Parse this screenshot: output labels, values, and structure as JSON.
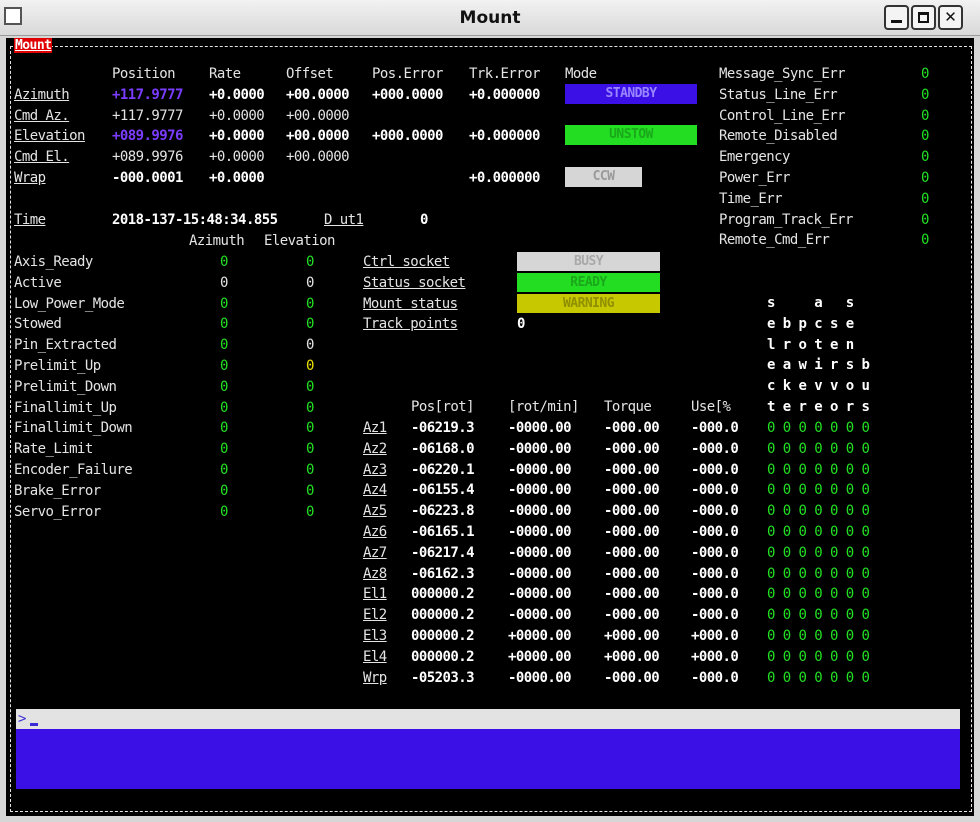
{
  "window": {
    "title": "Mount"
  },
  "frame_title": "Mount",
  "headers": {
    "position": "Position",
    "rate": "Rate",
    "offset": "Offset",
    "pos_error": "Pos.Error",
    "trk_error": "Trk.Error",
    "mode": "Mode"
  },
  "rows": {
    "azimuth": {
      "label": "Azimuth",
      "position": "+117.9777",
      "rate": "+0.0000",
      "offset": "+00.0000",
      "pos_error": "+000.0000",
      "trk_error": "+0.000000",
      "mode": "STANDBY"
    },
    "cmd_az": {
      "label": "Cmd Az.",
      "position": "+117.9777",
      "rate": "+0.0000",
      "offset": "+00.0000"
    },
    "elevation": {
      "label": "Elevation",
      "position": "+089.9976",
      "rate": "+0.0000",
      "offset": "+00.0000",
      "pos_error": "+000.0000",
      "trk_error": "+0.000000",
      "mode": "UNSTOW"
    },
    "cmd_el": {
      "label": "Cmd El.",
      "position": "+089.9976",
      "rate": "+0.0000",
      "offset": "+00.0000"
    },
    "wrap": {
      "label": "Wrap",
      "position": "-000.0001",
      "rate": "+0.0000",
      "trk_error": "+0.000000",
      "mode": "CCW"
    }
  },
  "time": {
    "label": "Time",
    "value": "2018-137-15:48:34.855",
    "dut1_label": "D ut1",
    "dut1_value": "0"
  },
  "axis_headers": {
    "azimuth": "Azimuth",
    "elevation": "Elevation"
  },
  "axis_status": [
    {
      "label": "Axis_Ready",
      "az": "0",
      "el": "0",
      "az_color": "g",
      "el_color": "g"
    },
    {
      "label": "Active",
      "az": "0",
      "el": "0",
      "az_color": "w",
      "el_color": "w"
    },
    {
      "label": "Low_Power_Mode",
      "az": "0",
      "el": "0",
      "az_color": "g",
      "el_color": "g"
    },
    {
      "label": "Stowed",
      "az": "0",
      "el": "0",
      "az_color": "g",
      "el_color": "g"
    },
    {
      "label": "Pin_Extracted",
      "az": "0",
      "el": "0",
      "az_color": "g",
      "el_color": "w"
    },
    {
      "label": "Prelimit_Up",
      "az": "0",
      "el": "0",
      "az_color": "g",
      "el_color": "y"
    },
    {
      "label": "Prelimit_Down",
      "az": "0",
      "el": "0",
      "az_color": "g",
      "el_color": "g"
    },
    {
      "label": "Finallimit_Up",
      "az": "0",
      "el": "0",
      "az_color": "g",
      "el_color": "g"
    },
    {
      "label": "Finallimit_Down",
      "az": "0",
      "el": "0",
      "az_color": "g",
      "el_color": "g"
    },
    {
      "label": "Rate_Limit",
      "az": "0",
      "el": "0",
      "az_color": "g",
      "el_color": "g"
    },
    {
      "label": "Encoder_Failure",
      "az": "0",
      "el": "0",
      "az_color": "g",
      "el_color": "g"
    },
    {
      "label": "Brake_Error",
      "az": "0",
      "el": "0",
      "az_color": "g",
      "el_color": "g"
    },
    {
      "label": "Servo_Error",
      "az": "0",
      "el": "0",
      "az_color": "g",
      "el_color": "g"
    }
  ],
  "status_links": [
    {
      "label": "Ctrl socket",
      "badge": "BUSY",
      "bg": "#d6d6d6",
      "fg": "#a8a8a8"
    },
    {
      "label": "Status socket",
      "badge": "READY",
      "bg": "#22dd22",
      "fg": "#1aa81a"
    },
    {
      "label": "Mount status",
      "badge": "WARNING",
      "bg": "#c8c800",
      "fg": "#8f8f00"
    },
    {
      "label": "Track points",
      "value": "0"
    }
  ],
  "errors": [
    {
      "label": "Message_Sync_Err",
      "value": "0"
    },
    {
      "label": "Status_Line_Err",
      "value": "0"
    },
    {
      "label": "Control_Line_Err",
      "value": "0"
    },
    {
      "label": "Remote_Disabled",
      "value": "0"
    },
    {
      "label": "Emergency",
      "value": "0"
    },
    {
      "label": "Power_Err",
      "value": "0"
    },
    {
      "label": "Time_Err",
      "value": "0"
    },
    {
      "label": "Program_Track_Err",
      "value": "0"
    },
    {
      "label": "Remote_Cmd_Err",
      "value": "0"
    }
  ],
  "motor_headers": {
    "pos": "Pos[rot]",
    "rpm": "[rot/min]",
    "torque": "Torque",
    "use": "Use[%"
  },
  "flag_header_rows": [
    "s     a   s  ",
    "e b p c s e  ",
    "l r o t e n  ",
    "e a w i r s b",
    "c k e v v o u",
    "t e r e o r s"
  ],
  "motors": [
    {
      "label": "Az1",
      "pos": "-06219.3",
      "rpm": "-0000.00",
      "torque": "-000.00",
      "use": "-000.0",
      "flags": "0 0 0 0 0 0 0"
    },
    {
      "label": "Az2",
      "pos": "-06168.0",
      "rpm": "-0000.00",
      "torque": "-000.00",
      "use": "-000.0",
      "flags": "0 0 0 0 0 0 0"
    },
    {
      "label": "Az3",
      "pos": "-06220.1",
      "rpm": "-0000.00",
      "torque": "-000.00",
      "use": "-000.0",
      "flags": "0 0 0 0 0 0 0"
    },
    {
      "label": "Az4",
      "pos": "-06155.4",
      "rpm": "-0000.00",
      "torque": "-000.00",
      "use": "-000.0",
      "flags": "0 0 0 0 0 0 0"
    },
    {
      "label": "Az5",
      "pos": "-06223.8",
      "rpm": "-0000.00",
      "torque": "-000.00",
      "use": "-000.0",
      "flags": "0 0 0 0 0 0 0"
    },
    {
      "label": "Az6",
      "pos": "-06165.1",
      "rpm": "-0000.00",
      "torque": "-000.00",
      "use": "-000.0",
      "flags": "0 0 0 0 0 0 0"
    },
    {
      "label": "Az7",
      "pos": "-06217.4",
      "rpm": "-0000.00",
      "torque": "-000.00",
      "use": "-000.0",
      "flags": "0 0 0 0 0 0 0"
    },
    {
      "label": "Az8",
      "pos": "-06162.3",
      "rpm": "-0000.00",
      "torque": "-000.00",
      "use": "-000.0",
      "flags": "0 0 0 0 0 0 0"
    },
    {
      "label": "El1",
      "pos": "000000.2",
      "rpm": "-0000.00",
      "torque": "-000.00",
      "use": "-000.0",
      "flags": "0 0 0 0 0 0 0"
    },
    {
      "label": "El2",
      "pos": "000000.2",
      "rpm": "-0000.00",
      "torque": "-000.00",
      "use": "-000.0",
      "flags": "0 0 0 0 0 0 0"
    },
    {
      "label": "El3",
      "pos": "000000.2",
      "rpm": "+0000.00",
      "torque": "+000.00",
      "use": "+000.0",
      "flags": "0 0 0 0 0 0 0"
    },
    {
      "label": "El4",
      "pos": "000000.2",
      "rpm": "+0000.00",
      "torque": "+000.00",
      "use": "+000.0",
      "flags": "0 0 0 0 0 0 0"
    },
    {
      "label": "Wrp",
      "pos": "-05203.3",
      "rpm": "-0000.00",
      "torque": "-000.00",
      "use": "-000.0",
      "flags": "0 0 0 0 0 0 0"
    }
  ],
  "command_line": {
    "prompt": ">",
    "value": ""
  },
  "colors": {
    "standby": "#3a10e6",
    "unstow": "#22dd22",
    "ccw": "#d6d6d6",
    "console": "#3a10e6",
    "highlight": "#7b3cff"
  }
}
